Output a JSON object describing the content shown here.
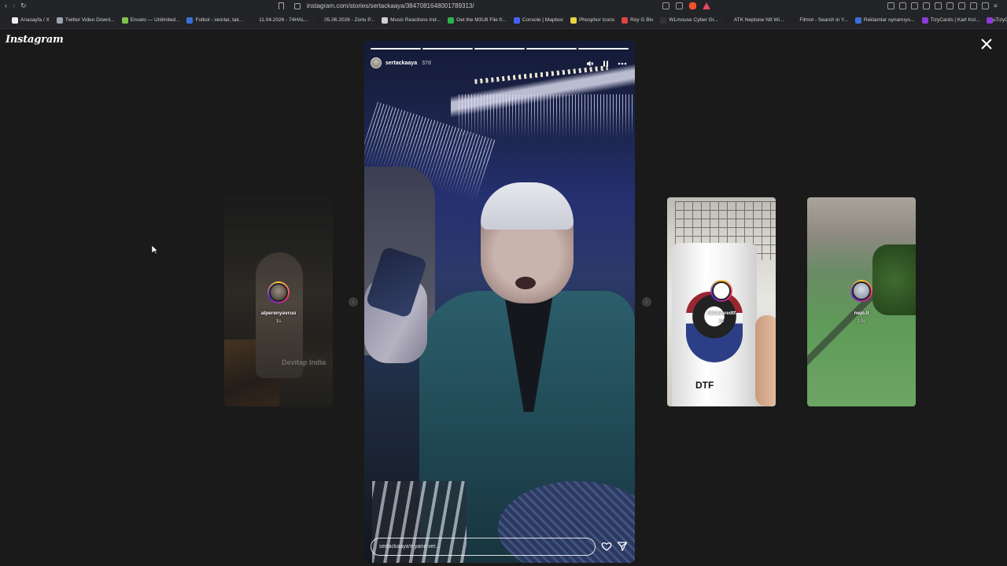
{
  "browser": {
    "url": "instagram.com/stories/sertackaaya/3847081648001789313/",
    "bookmarks": [
      {
        "label": "Anasayfa / X",
        "color": "#eeeeee"
      },
      {
        "label": "Twitter Video Downl...",
        "color": "#9ba3ad"
      },
      {
        "label": "Envato — Unlimited...",
        "color": "#7fc34b"
      },
      {
        "label": "Futbol - skorlar, tak...",
        "color": "#3a6fd8"
      },
      {
        "label": "11.04.2026 - 74HAL...",
        "color": "#222222"
      },
      {
        "label": "05.06.2026 - Zorlu P...",
        "color": "#222222"
      },
      {
        "label": "Music Reactions Ind...",
        "color": "#d0d0d0"
      },
      {
        "label": "Get the M3U8 File fr...",
        "color": "#2db34a"
      },
      {
        "label": "Console | Mapbox",
        "color": "#4264fb"
      },
      {
        "label": "Phosphor Icons",
        "color": "#e9d344"
      },
      {
        "label": "Roy G Biv",
        "color": "#d44"
      },
      {
        "label": "WLmouse Cyber Gr...",
        "color": "#333333"
      },
      {
        "label": "ATK Neptune N9 Wi...",
        "color": "#222222"
      },
      {
        "label": "Filmot - Search in Y...",
        "color": "#222222"
      },
      {
        "label": "Reklamlar oynamıyo...",
        "color": "#3a6fd8"
      },
      {
        "label": "TizyCards | Kart Kol...",
        "color": "#8a3bd8"
      },
      {
        "label": "TizyCards | Kart Kol...",
        "color": "#8a3bd8"
      }
    ]
  },
  "page": {
    "logo": "Instagram"
  },
  "story": {
    "username": "sertackaaya",
    "time": "37d",
    "segments_total": 5,
    "segments_done": 5,
    "reply_placeholder": "sertackaaya'e yanıt ver..."
  },
  "side_stories": [
    {
      "username": "alperenyavruu",
      "time": "1s",
      "watermark": "Devitap India"
    },
    {
      "username": "delawaredtf",
      "time": "1s"
    },
    {
      "username": "nejo.ll",
      "time": "13s"
    }
  ],
  "icons": {
    "close": "close-icon",
    "mute": "speaker-muted-icon",
    "pause": "pause-icon",
    "more": "more-horizontal-icon",
    "like": "heart-icon",
    "share": "send-icon",
    "prev": "chevron-left-icon",
    "next": "chevron-right-icon"
  }
}
